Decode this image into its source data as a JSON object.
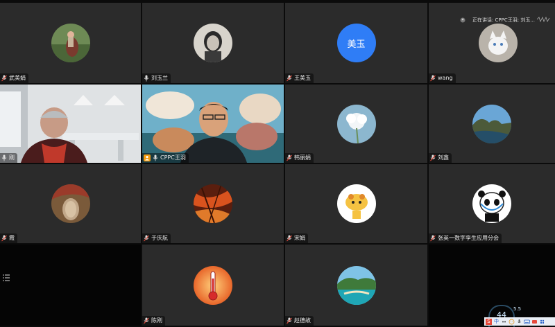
{
  "speaking_indicator": {
    "label": "正在讲话: CPPC王羽; 刘玉..."
  },
  "participants": [
    {
      "name": "武美娟"
    },
    {
      "name": "刘玉兰"
    },
    {
      "name": "王美玉",
      "avatar_text": "美玉"
    },
    {
      "name": "wang"
    },
    {
      "name": "刚"
    },
    {
      "name": "CPPC王羽"
    },
    {
      "name": "韩丽娟"
    },
    {
      "name": "刘鑫"
    },
    {
      "name": "霞"
    },
    {
      "name": "于庆航"
    },
    {
      "name": "宋娟"
    },
    {
      "name": "张英一数字孪生应用分会"
    },
    {
      "name": "陈刚"
    },
    {
      "name": "赵德故"
    }
  ],
  "status": {
    "timer_value": "44",
    "speed": "5.5"
  },
  "taskbar": {
    "ime_label": "中"
  },
  "colors": {
    "host_badge": "#f39c12",
    "active_outline": "#1aa37a",
    "avatar_blue": "#2f7df6"
  }
}
